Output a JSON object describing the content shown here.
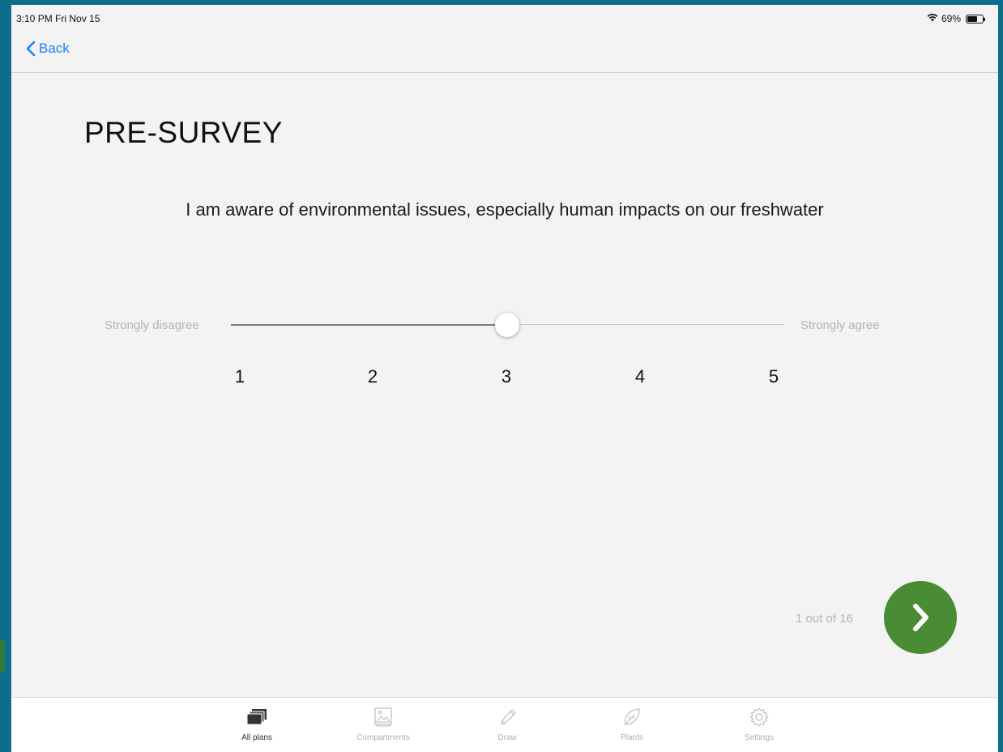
{
  "status_bar": {
    "time": "3:10 PM  Fri Nov 15",
    "battery": "69%",
    "battery_level": 0.69
  },
  "nav": {
    "back_label": "Back"
  },
  "survey": {
    "title": "PRE-SURVEY",
    "question": "I am aware of environmental issues, especially human impacts on our freshwater",
    "scale_min_label": "Strongly disagree",
    "scale_max_label": "Strongly agree",
    "ticks": [
      "1",
      "2",
      "3",
      "4",
      "5"
    ],
    "selected_value": 3,
    "progress": "1 out of 16"
  },
  "tabbar": {
    "items": [
      {
        "label": "All plans",
        "icon": "stack-icon",
        "active": true
      },
      {
        "label": "Compartments",
        "icon": "image-icon",
        "active": false
      },
      {
        "label": "Draw",
        "icon": "pencil-icon",
        "active": false
      },
      {
        "label": "Plants",
        "icon": "leaf-icon",
        "active": false
      },
      {
        "label": "Settings",
        "icon": "gear-icon",
        "active": false
      }
    ]
  },
  "colors": {
    "accent_blue": "#1a82f7",
    "next_button_green": "#4a8b35",
    "background": "#f3f3f3"
  }
}
